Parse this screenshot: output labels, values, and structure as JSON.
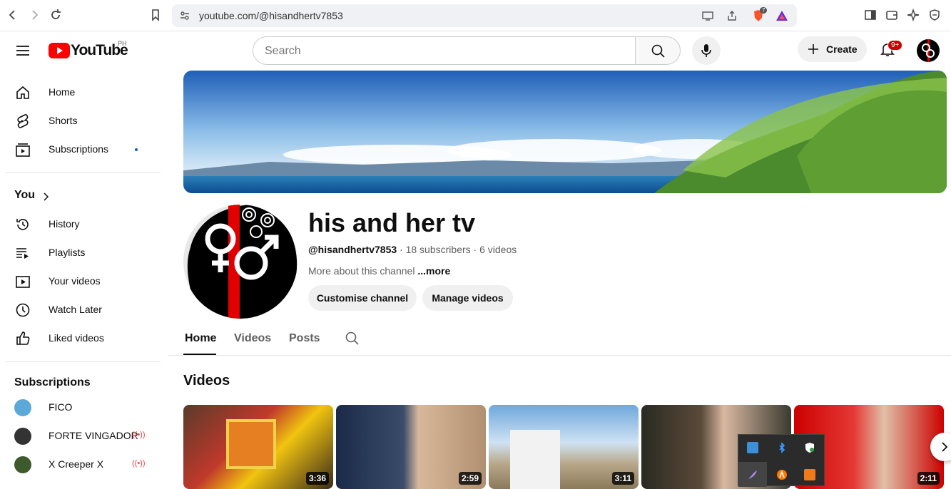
{
  "browser": {
    "url": "youtube.com/@hisandhertv7853",
    "brave_badge": "7"
  },
  "header": {
    "logo_text": "YouTube",
    "region": "PH",
    "search_placeholder": "Search",
    "create_label": "Create",
    "notif_badge": "9+"
  },
  "sidebar": {
    "main": [
      {
        "label": "Home",
        "icon": "home-icon"
      },
      {
        "label": "Shorts",
        "icon": "shorts-icon"
      },
      {
        "label": "Subscriptions",
        "icon": "subscriptions-icon"
      }
    ],
    "you_label": "You",
    "you_items": [
      {
        "label": "History",
        "icon": "history-icon"
      },
      {
        "label": "Playlists",
        "icon": "playlists-icon"
      },
      {
        "label": "Your videos",
        "icon": "your-videos-icon"
      },
      {
        "label": "Watch Later",
        "icon": "watch-later-icon"
      },
      {
        "label": "Liked videos",
        "icon": "liked-icon"
      }
    ],
    "subscriptions_label": "Subscriptions",
    "subscriptions": [
      {
        "label": "FICO",
        "live": false,
        "color": "#5aa9d8"
      },
      {
        "label": "FORTE VINGADOR",
        "live": true,
        "color": "#333333"
      },
      {
        "label": "X Creeper X",
        "live": true,
        "color": "#3c5a2c"
      }
    ]
  },
  "channel": {
    "name": "his and her tv",
    "handle": "@hisandhertv7853",
    "subscribers": "· 18 subscribers",
    "videos_count": "· 6 videos",
    "about": "More about this channel",
    "more": "...more",
    "customise": "Customise channel",
    "manage": "Manage videos"
  },
  "tabs": [
    {
      "label": "Home",
      "active": true
    },
    {
      "label": "Videos",
      "active": false
    },
    {
      "label": "Posts",
      "active": false
    }
  ],
  "videos_section": {
    "title": "Videos",
    "items": [
      {
        "duration": "3:36"
      },
      {
        "duration": "2:59"
      },
      {
        "duration": "3:11"
      },
      {
        "duration": ""
      },
      {
        "duration": "2:11"
      }
    ]
  },
  "colors": {
    "brand_red": "#ff0000",
    "live_red": "#ff3b3b",
    "sub_dot": "#065fd4"
  }
}
